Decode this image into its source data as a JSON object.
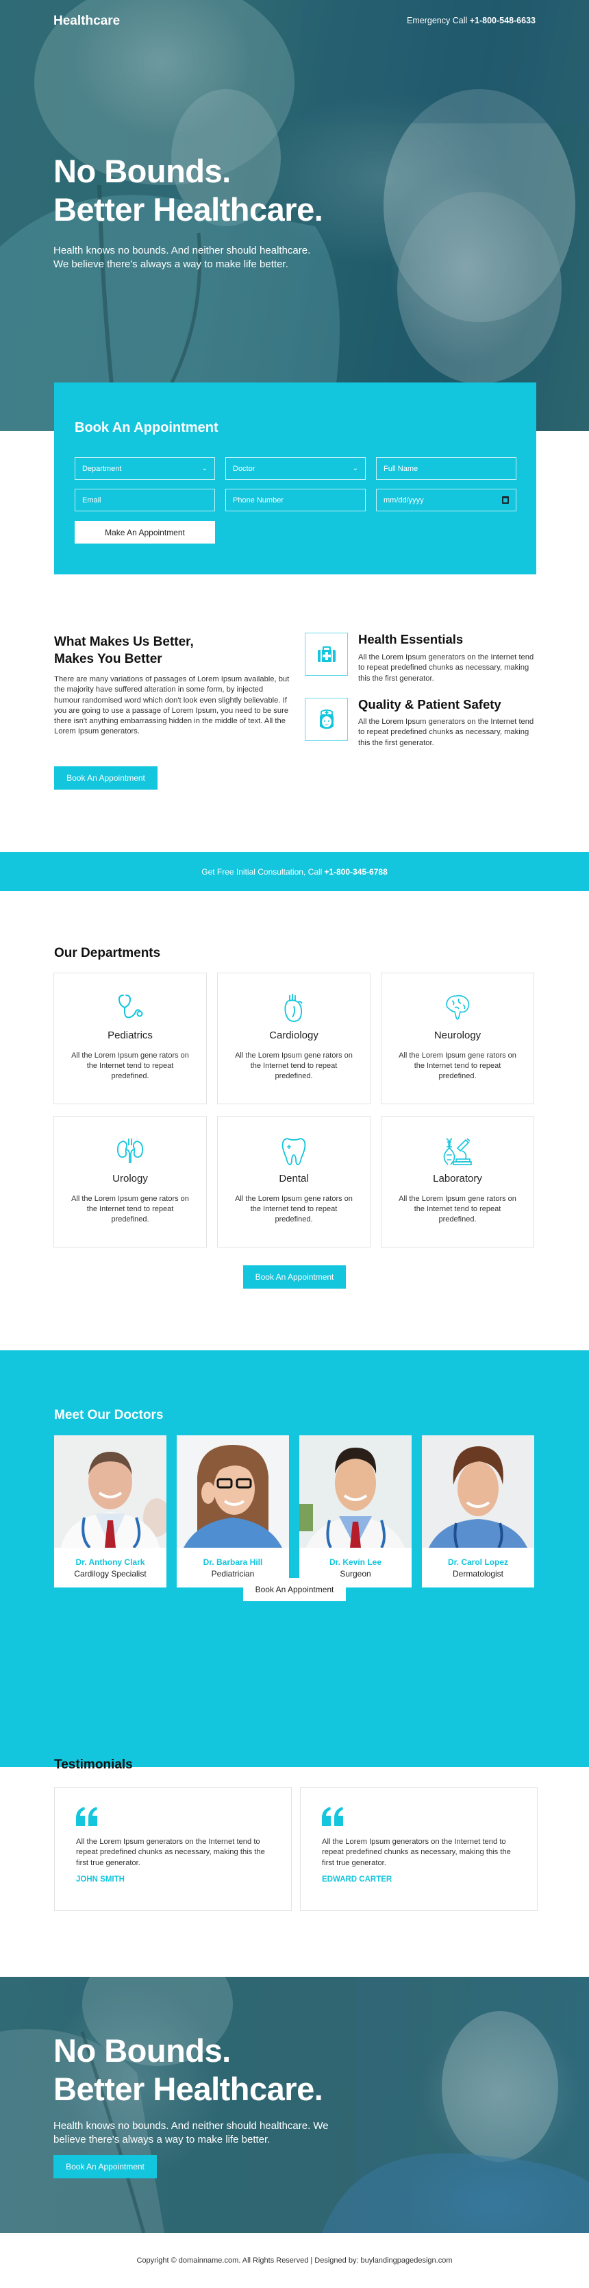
{
  "colors": {
    "accent": "#13c5dd",
    "heading": "#111111",
    "text": "#333333"
  },
  "header": {
    "brand": "Healthcare",
    "emergency_label": "Emergency Call",
    "emergency_phone": "+1-800-548-6633"
  },
  "hero": {
    "title_line1": "No Bounds.",
    "title_line2": "Better Healthcare.",
    "subtitle_line1": "Health knows no bounds. And neither should healthcare.",
    "subtitle_line2": "We believe there's always a way to make life better."
  },
  "appointment": {
    "title": "Book An Appointment",
    "department": {
      "value": "Department",
      "icon": "chevron-down-icon"
    },
    "doctor": {
      "value": "Doctor",
      "icon": "chevron-down-icon"
    },
    "full_name": {
      "placeholder": "Full Name"
    },
    "email": {
      "placeholder": "Email"
    },
    "phone": {
      "placeholder": "Phone Number"
    },
    "date": {
      "placeholder": "mm/dd/yyyy",
      "icon": "calendar-icon"
    },
    "submit_label": "Make An Appointment"
  },
  "about": {
    "title_line1": "What Makes Us Better,",
    "title_line2": "Makes You Better",
    "text": "There are many variations of passages of Lorem Ipsum available, but the majority have suffered alteration in some form, by injected humour randomised word which don't look even slightly believable. If you are going to use a passage of Lorem Ipsum, you need to be sure there isn't anything embarrassing hidden in the middle of text. All the Lorem Ipsum generators.",
    "button_label": "Book An Appointment",
    "features": [
      {
        "icon": "first-aid-kit-icon",
        "title": "Health Essentials",
        "text": "All the Lorem Ipsum generators on the Internet tend to repeat predefined chunks as necessary, making this the first generator."
      },
      {
        "icon": "nurse-icon",
        "title": "Quality & Patient Safety",
        "text": "All the Lorem Ipsum generators on the Internet tend to repeat predefined chunks as necessary, making this the first generator."
      }
    ]
  },
  "band": {
    "text": "Get Free Initial Consultation, Call",
    "phone": "+1-800-345-6788"
  },
  "departments": {
    "title": "Our Departments",
    "items": [
      {
        "icon": "stethoscope-icon",
        "name": "Pediatrics",
        "text": "All the Lorem Ipsum gene rators on the Internet tend to repeat predefined."
      },
      {
        "icon": "heart-icon",
        "name": "Cardiology",
        "text": "All the Lorem Ipsum gene rators on the Internet tend to repeat predefined."
      },
      {
        "icon": "brain-icon",
        "name": "Neurology",
        "text": "All the Lorem Ipsum gene rators on the Internet tend to repeat predefined."
      },
      {
        "icon": "kidneys-icon",
        "name": "Urology",
        "text": "All the Lorem Ipsum gene rators on the Internet tend to repeat predefined."
      },
      {
        "icon": "tooth-icon",
        "name": "Dental",
        "text": "All the Lorem Ipsum gene rators on the Internet tend to repeat predefined."
      },
      {
        "icon": "microscope-dna-icon",
        "name": "Laboratory",
        "text": "All the Lorem Ipsum gene rators on the Internet tend to repeat predefined."
      }
    ],
    "button_label": "Book An Appointment"
  },
  "doctors": {
    "title": "Meet Our Doctors",
    "items": [
      {
        "name": "Dr. Anthony Clark",
        "role": "Cardilogy Specialist"
      },
      {
        "name": "Dr. Barbara Hill",
        "role": "Pediatrician"
      },
      {
        "name": "Dr. Kevin Lee",
        "role": "Surgeon"
      },
      {
        "name": "Dr. Carol Lopez",
        "role": "Dermatologist"
      }
    ],
    "button_label": "Book An Appointment"
  },
  "testimonials": {
    "title": "Testimonials",
    "items": [
      {
        "text": "All the Lorem Ipsum generators on the Internet tend to repeat predefined chunks as necessary, making this the first true generator.",
        "name": "JOHN SMITH"
      },
      {
        "text": "All the Lorem Ipsum generators on the Internet tend to repeat predefined chunks as necessary, making this the first true generator.",
        "name": "EDWARD CARTER"
      }
    ]
  },
  "hero_bottom": {
    "title_line1": "No Bounds.",
    "title_line2": "Better Healthcare.",
    "subtitle": "Health knows no bounds. And neither should healthcare. We believe there's always a way to make life better.",
    "button_label": "Book An Appointment"
  },
  "footer": {
    "text": "Copyright © domainname.com. All Rights Reserved | Designed by: buylandingpagedesign.com"
  }
}
